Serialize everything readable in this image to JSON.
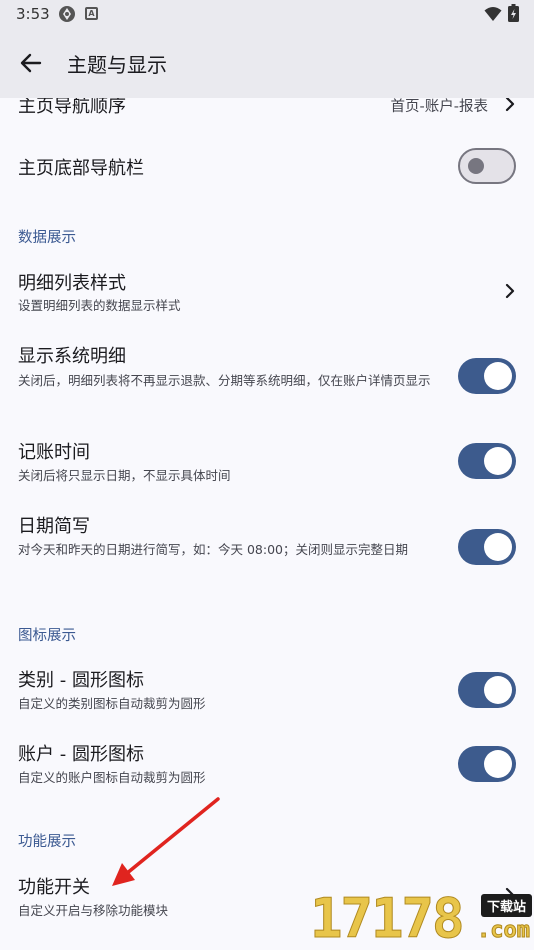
{
  "status_bar": {
    "time": "3:53",
    "icons": [
      "app-notification-icon",
      "a-notification-icon",
      "wifi-icon",
      "battery-icon"
    ],
    "badge_letter": "A"
  },
  "app_bar": {
    "title": "主题与显示",
    "back_icon": "arrow-left-icon"
  },
  "rows": {
    "nav_order": {
      "title": "主页导航顺序",
      "value": "首页-账户-报表"
    },
    "bottom_nav": {
      "title": "主页底部导航栏",
      "switch_on": false
    }
  },
  "sections": {
    "data_display": {
      "header": "数据展示",
      "detail_list_style": {
        "title": "明细列表样式",
        "subtitle": "设置明细列表的数据显示样式"
      },
      "show_system_details": {
        "title": "显示系统明细",
        "subtitle": "关闭后，明细列表将不再显示退款、分期等系统明细，仅在账户详情页显示",
        "switch_on": true
      },
      "record_time": {
        "title": "记账时间",
        "subtitle": "关闭后将只显示日期，不显示具体时间",
        "switch_on": true
      },
      "date_short": {
        "title": "日期简写",
        "subtitle": "对今天和昨天的日期进行简写，如：今天 08:00；关闭则显示完整日期",
        "switch_on": true
      }
    },
    "icon_display": {
      "header": "图标展示",
      "category_round": {
        "title": "类别 - 圆形图标",
        "subtitle": "自定义的类别图标自动裁剪为圆形",
        "switch_on": true
      },
      "account_round": {
        "title": "账户 - 圆形图标",
        "subtitle": "自定义的账户图标自动裁剪为圆形",
        "switch_on": true
      }
    },
    "feature_display": {
      "header": "功能展示",
      "feature_toggle": {
        "title": "功能开关",
        "subtitle": "自定义开启与移除功能模块"
      }
    }
  },
  "overlay": {
    "arrow_color": "#e0241f",
    "watermark": {
      "digits": "17178",
      "badge": "下载站",
      "domain": ".com"
    }
  },
  "colors": {
    "accent": "#3d5b8d",
    "section_header": "#3c5a92",
    "background": "#f9f9fd",
    "app_bar": "#eaeaef"
  }
}
